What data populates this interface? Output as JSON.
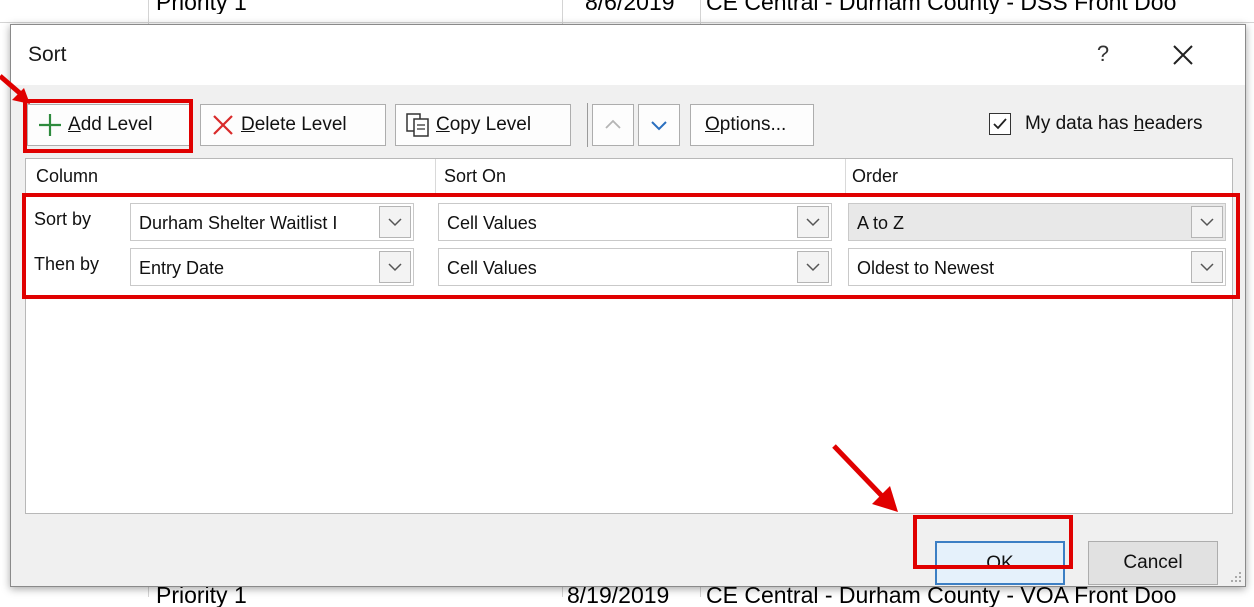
{
  "background_sheet": {
    "top_row": {
      "priority": "Priority 1",
      "date": "8/6/2019",
      "location": "CE Central - Durham County - DSS Front Doo"
    },
    "bottom_row": {
      "priority": "Priority 1",
      "date": "8/19/2019",
      "location": "CE Central - Durham County - VOA Front Doo"
    }
  },
  "dialog": {
    "title": "Sort",
    "help": "?",
    "toolbar": {
      "add_level": {
        "underlined": "A",
        "rest": "dd Level"
      },
      "delete_level": {
        "underlined": "D",
        "rest": "elete Level"
      },
      "copy_level": {
        "underlined": "C",
        "rest": "opy Level"
      },
      "options": {
        "underlined": "O",
        "rest": "ptions..."
      },
      "headers_checkbox": {
        "label_pre": "My data has ",
        "underlined": "h",
        "label_post": "eaders",
        "checked": true
      }
    },
    "columns": {
      "column": "Column",
      "sort_on": "Sort On",
      "order": "Order"
    },
    "rows": [
      {
        "label": "Sort by",
        "column": "Durham Shelter Waitlist I",
        "sort_on": "Cell Values",
        "order": "A to Z"
      },
      {
        "label": "Then by",
        "column": "Entry Date",
        "sort_on": "Cell Values",
        "order": "Oldest to Newest"
      }
    ],
    "buttons": {
      "ok": "OK",
      "cancel": "Cancel"
    }
  },
  "colors": {
    "highlight": "#e00000",
    "accent": "#3c7fc4",
    "add_icon": "#2e8b3e",
    "delete_icon": "#d92b2b"
  }
}
